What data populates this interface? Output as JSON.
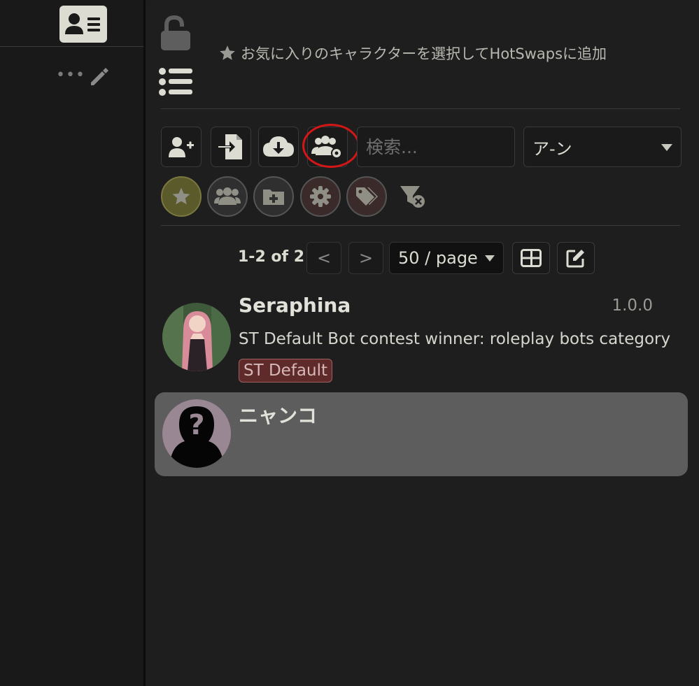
{
  "sidebar": {
    "tab_icon": "character-card-icon",
    "more_icon": "ellipsis-icon",
    "edit_icon": "pencil-icon"
  },
  "header": {
    "lock_icon": "unlock-icon",
    "list_icon": "list-icon",
    "favorites_hint": "お気に入りのキャラクターを選択してHotSwapsに追加"
  },
  "toolbar": {
    "buttons": [
      "add-character",
      "import-character",
      "cloud-download",
      "group-manage"
    ],
    "search": {
      "placeholder": "検索...",
      "value": ""
    },
    "sort": {
      "selected": "ア-ン"
    }
  },
  "filters": {
    "buttons": [
      {
        "name": "favorites",
        "color": "#6b6a2e"
      },
      {
        "name": "groups",
        "color": "#3a3a3a"
      },
      {
        "name": "folders",
        "color": "#3a3a3a"
      },
      {
        "name": "settings",
        "color": "#4a2e2e"
      },
      {
        "name": "tags",
        "color": "#4a2e2e"
      }
    ],
    "clear_icon": "filter-clear-icon"
  },
  "pagination": {
    "range_text": "1-2 of 2",
    "prev_label": "<",
    "next_label": ">",
    "page_size": "50 / page"
  },
  "characters": [
    {
      "name": "Seraphina",
      "version": "1.0.0",
      "description": "ST Default Bot contest winner: roleplay bots category",
      "tag": "ST Default"
    },
    {
      "name": "ニャンコ",
      "version": "",
      "description": "",
      "tag": ""
    }
  ],
  "colors": {
    "background": "#1e1e1e",
    "accent_light": "#dcdcd2",
    "selected_row": "#5d5d5d",
    "highlight_ring": "#d41616"
  }
}
